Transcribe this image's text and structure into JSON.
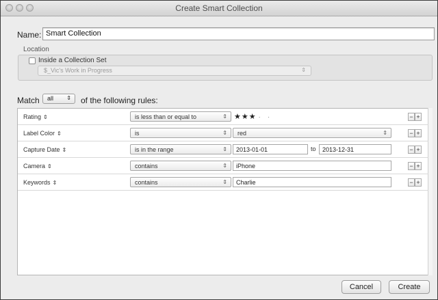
{
  "window": {
    "title": "Create Smart Collection"
  },
  "name": {
    "label": "Name:",
    "value": "Smart Collection"
  },
  "location": {
    "label": "Location",
    "inside_set_label": "Inside a Collection Set",
    "inside_set_checked": false,
    "collection_set_value": "$_Vic's Work in Progress"
  },
  "match": {
    "label": "Match",
    "value": "all",
    "suffix": "of the following rules:"
  },
  "rules": [
    {
      "field": "Rating",
      "operator": "is less than or equal to",
      "stars": "★★★",
      "empty_stars": "· ·",
      "star_rating": 3
    },
    {
      "field": "Label Color",
      "operator": "is",
      "value": "red"
    },
    {
      "field": "Capture Date",
      "operator": "is in the range",
      "value": "2013-01-01",
      "to_label": "to",
      "value2": "2013-12-31"
    },
    {
      "field": "Camera",
      "operator": "contains",
      "value": "iPhone"
    },
    {
      "field": "Keywords",
      "operator": "contains",
      "value": "Charlie"
    }
  ],
  "controls": {
    "remove": "−",
    "add": "+",
    "updown": "⇕",
    "select_arrows": "⇕"
  },
  "buttons": {
    "cancel": "Cancel",
    "create": "Create"
  }
}
